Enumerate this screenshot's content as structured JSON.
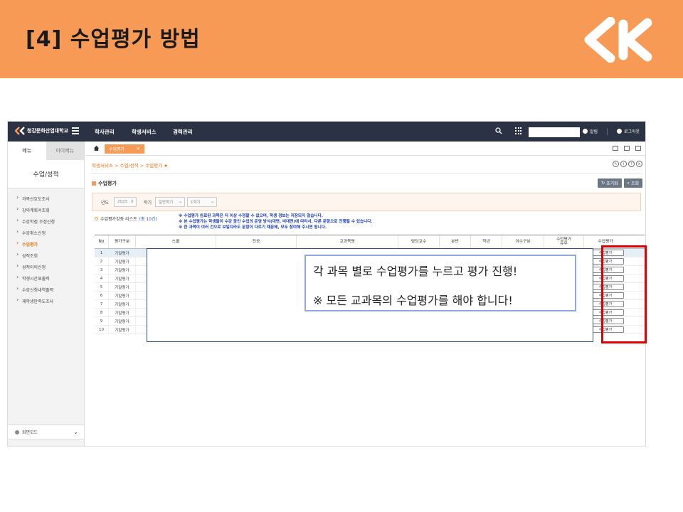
{
  "slide": {
    "title": "[4]  수업평가  방법",
    "header_color": "#F79A55"
  },
  "app": {
    "brand": "청강문화산업대학교",
    "menu": [
      "학사관리",
      "학생서비스",
      "경력관리"
    ],
    "user_label": "알림",
    "logout_label": "로그아웃"
  },
  "sidebar": {
    "tabs": [
      "메뉴",
      "마이메뉴"
    ],
    "heading": "수업/성적",
    "items": [
      {
        "label": "과목선호도조사"
      },
      {
        "label": "강의계획서조회"
      },
      {
        "label": "수강학점 조정신청"
      },
      {
        "label": "수강취소신청"
      },
      {
        "label": "수업평가",
        "active": true
      },
      {
        "label": "성적조회"
      },
      {
        "label": "성적이의신청"
      },
      {
        "label": "학생시간표출력"
      },
      {
        "label": "수강신청내역출력"
      },
      {
        "label": "재학생만족도조사"
      }
    ],
    "screen_mode": "화면모드"
  },
  "content": {
    "open_tab": "수업평가",
    "breadcrumb": "학생서비스 > 수업/성적 > 수업평가",
    "page_title": "수업평가",
    "buttons": {
      "reset": "초기화",
      "search": "조회"
    },
    "filter": {
      "year_label": "년도",
      "year_value": "2023",
      "term_label": "학기",
      "term_type": "일반학기",
      "term_value": "1학기"
    },
    "list_title": "수업평가강좌 리스트",
    "list_count": "(총 10건)",
    "notes": [
      "※ 수업평가 완료된 과목은 더 이상 수정할 수 없으며, 학생 정보는 저장되지 않습니다.",
      "※ 본 수업평가는 학생들이 수강 중인 수업의 운영 방식(대면, 비대면)에 따라서, 다른 문항으로 진행될 수 있습니다.",
      "※ 한 과목이 여러 건으로 보일지라도 문항이 다르기 때문에, 모두 참여해 주시면 됩니다."
    ],
    "columns": [
      "No",
      "평가구분",
      "스쿨",
      "전공",
      "교과목명",
      "담당교수",
      "분반",
      "학년",
      "이수구분",
      "수업평가\n유무",
      "수업평가"
    ],
    "rows": [
      {
        "no": "1",
        "type": "기말평가",
        "button": "수업평가"
      },
      {
        "no": "2",
        "type": "기말평가",
        "button": "수업평가"
      },
      {
        "no": "3",
        "type": "기말평가",
        "button": "수업평가"
      },
      {
        "no": "4",
        "type": "기말평가",
        "button": "수업평가"
      },
      {
        "no": "5",
        "type": "기말평가",
        "button": "수업평가"
      },
      {
        "no": "6",
        "type": "기말평가",
        "button": "수업평가"
      },
      {
        "no": "7",
        "type": "기말평가",
        "button": "수업평가"
      },
      {
        "no": "8",
        "type": "기말평가",
        "button": "수업평가"
      },
      {
        "no": "9",
        "type": "기말평가",
        "button": "수업평가"
      },
      {
        "no": "10",
        "type": "기말평가",
        "button": "수업평가"
      }
    ]
  },
  "callout": {
    "line1": "각 과목 별로 수업평가를 누르고 평가 진행!",
    "line2": "※ 모든 교과목의 수업평가를 해야 합니다!"
  }
}
